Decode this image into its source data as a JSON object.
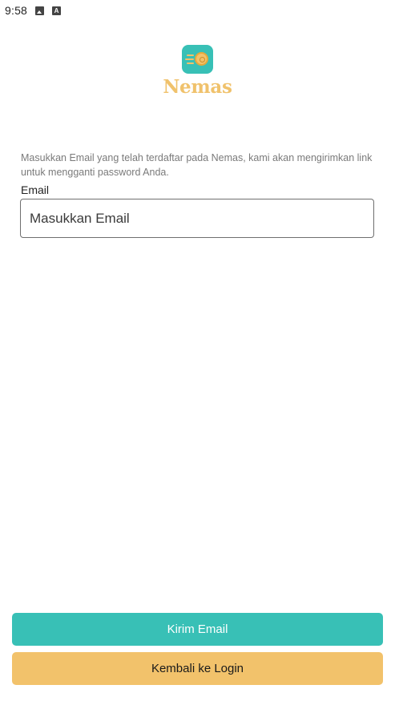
{
  "status_bar": {
    "time": "9:58",
    "icons": [
      "image-icon",
      "text-a-icon"
    ]
  },
  "brand": {
    "name": "Nemas",
    "logo_icon": "coin-speed-icon",
    "colors": {
      "primary": "#38c0b6",
      "gold": "#f2c26b"
    }
  },
  "form": {
    "description": "Masukkan Email yang telah terdaftar pada Nemas, kami akan mengirimkan link untuk mengganti password Anda.",
    "email_label": "Email",
    "email_value": "",
    "email_placeholder": "Masukkan Email"
  },
  "actions": {
    "submit_label": "Kirim Email",
    "back_label": "Kembali ke Login"
  }
}
